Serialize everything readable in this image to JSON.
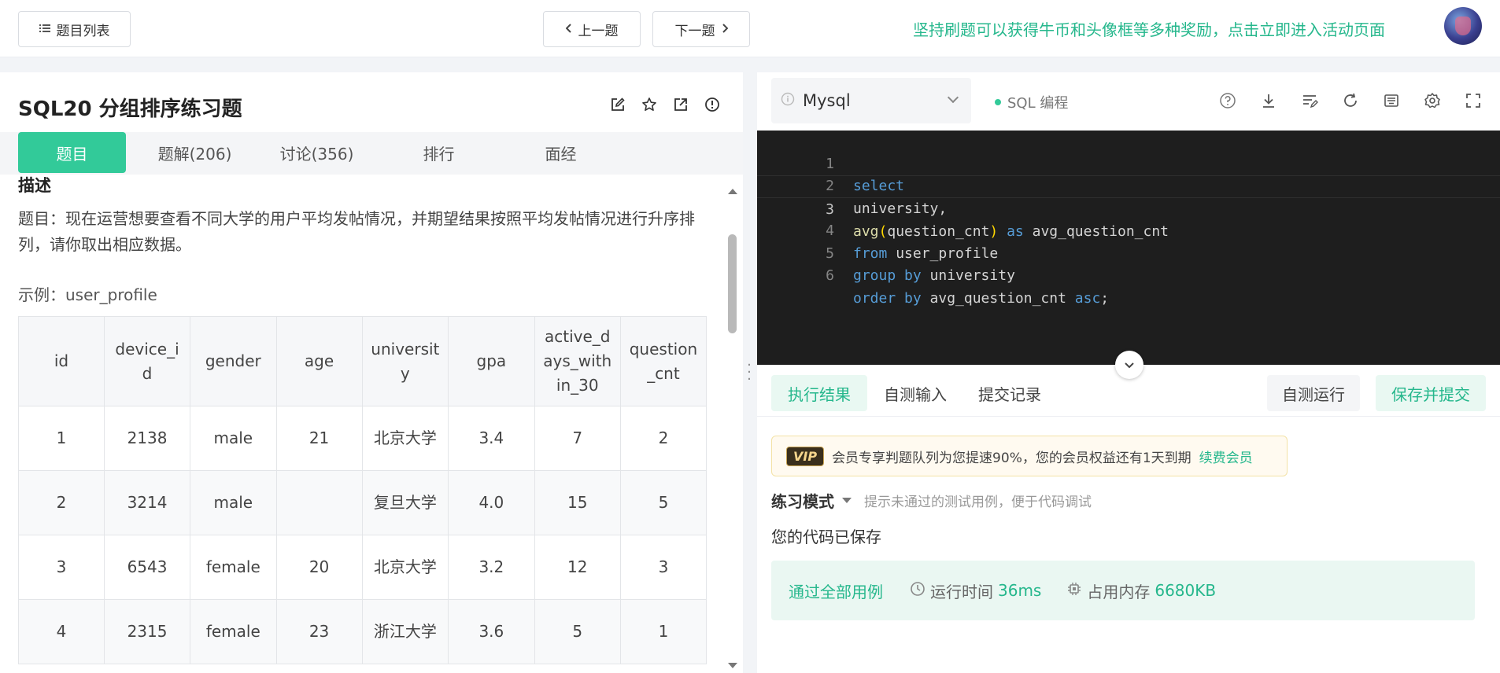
{
  "topbar": {
    "problem_list": "题目列表",
    "prev": "上一题",
    "next": "下一题",
    "promo": "坚持刷题可以获得牛币和头像框等多种奖励，点击立即进入活动页面"
  },
  "problem": {
    "title": "SQL20  分组排序练习题",
    "tabs": [
      "题目",
      "题解(206)",
      "讨论(356)",
      "排行",
      "面经"
    ],
    "desc_heading": "描述",
    "desc_text": "题目：现在运营想要查看不同大学的用户平均发帖情况，并期望结果按照平均发帖情况进行升序排列，请你取出相应数据。",
    "example_label": "示例：user_profile",
    "table": {
      "headers": [
        "id",
        "device_id",
        "gender",
        "age",
        "university",
        "gpa",
        "active_days_within_30",
        "question_cnt"
      ],
      "rows": [
        [
          "1",
          "2138",
          "male",
          "21",
          "北京大学",
          "3.4",
          "7",
          "2"
        ],
        [
          "2",
          "3214",
          "male",
          "",
          "复旦大学",
          "4.0",
          "15",
          "5"
        ],
        [
          "3",
          "6543",
          "female",
          "20",
          "北京大学",
          "3.2",
          "12",
          "3"
        ],
        [
          "4",
          "2315",
          "female",
          "23",
          "浙江大学",
          "3.6",
          "5",
          "1"
        ]
      ]
    }
  },
  "editor": {
    "language": "Mysql",
    "mode_tag": "SQL 编程",
    "lines": [
      "select",
      "university,",
      "avg(question_cnt) as avg_question_cnt",
      "from user_profile",
      "group by university",
      "order by avg_question_cnt asc;"
    ]
  },
  "results": {
    "tabs": [
      "执行结果",
      "自测输入",
      "提交记录"
    ],
    "run_button": "自测运行",
    "submit_button": "保存并提交",
    "vip_badge": "VIP",
    "vip_text": "会员专享判题队列为您提速90%，您的会员权益还有1天到期",
    "vip_link": "续费会员",
    "mode": "练习模式",
    "mode_hint": "提示未通过的测试用例，便于代码调试",
    "saved_msg": "您的代码已保存",
    "pass_text": "通过全部用例",
    "runtime_label": "运行时间",
    "runtime_value": "36ms",
    "memory_label": "占用内存",
    "memory_value": "6680KB"
  },
  "colors": {
    "accent": "#32ca99",
    "accent_text": "#25b78c",
    "editor_bg": "#1e1e1e"
  }
}
